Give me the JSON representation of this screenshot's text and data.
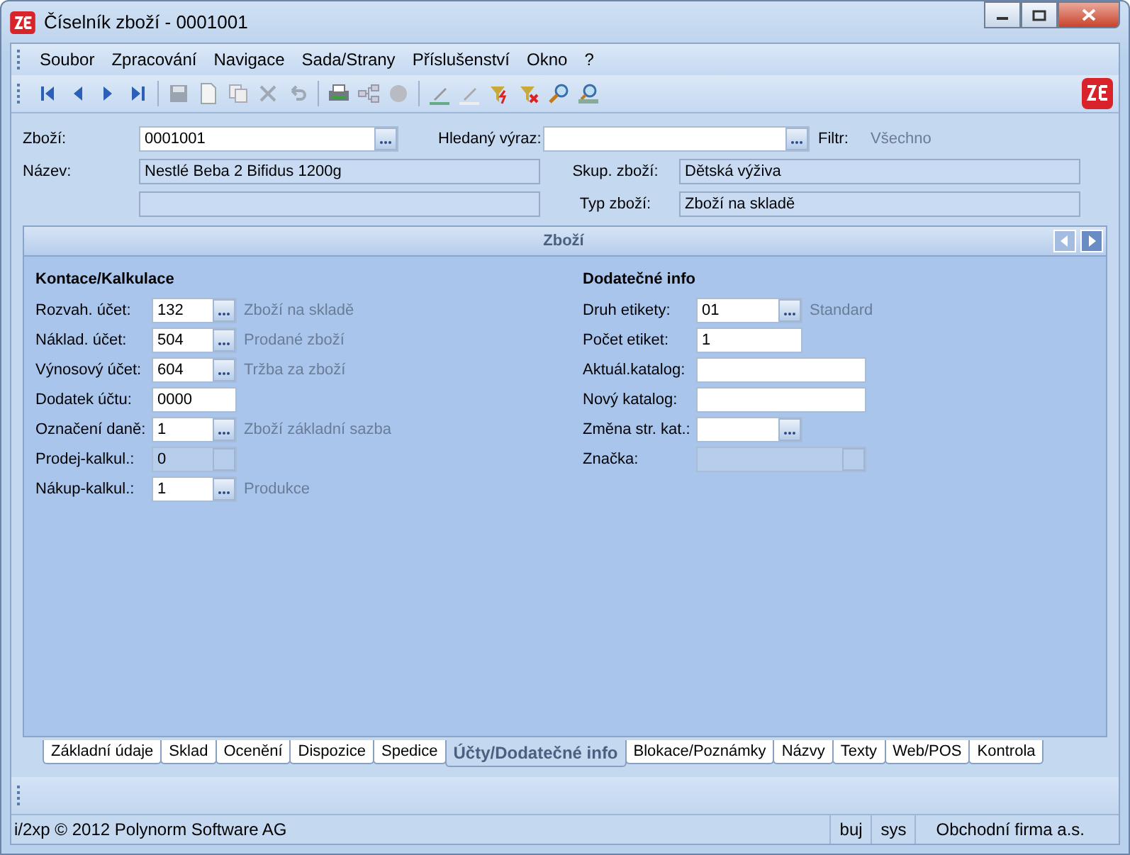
{
  "window": {
    "title": "Číselník zboží - 0001001"
  },
  "menu": [
    "Soubor",
    "Zpracování",
    "Navigace",
    "Sada/Strany",
    "Příslušenství",
    "Okno",
    "?"
  ],
  "header": {
    "zbozi": {
      "label": "Zboží:",
      "value": "0001001"
    },
    "search": {
      "label": "Hledaný výraz:"
    },
    "filter": {
      "label": "Filtr:",
      "value": "Všechno"
    },
    "nazev": {
      "label": "Název:",
      "value": "Nestlé Beba 2 Bifidus 1200g"
    },
    "skup": {
      "label": "Skup. zboží:",
      "value": "Dětská výživa"
    },
    "typ": {
      "label": "Typ zboží:",
      "value": "Zboží na skladě"
    }
  },
  "panel": {
    "title": "Zboží",
    "left": {
      "heading": "Kontace/Kalkulace",
      "fields": [
        {
          "label": "Rozvah. účet:",
          "value": "132",
          "kind": "lookup",
          "disabled": false,
          "note": "Zboží na skladě"
        },
        {
          "label": "Náklad. účet:",
          "value": "504",
          "kind": "lookup",
          "disabled": false,
          "note": "Prodané zboží"
        },
        {
          "label": "Výnosový účet:",
          "value": "604",
          "kind": "lookup",
          "disabled": false,
          "note": "Tržba za zboží"
        },
        {
          "label": "Dodatek účtu:",
          "value": "0000",
          "kind": "text",
          "disabled": false
        },
        {
          "label": "Označení daně:",
          "value": "1",
          "kind": "lookup",
          "disabled": false,
          "note": "Zboží základní sazba"
        },
        {
          "label": "Prodej-kalkul.:",
          "value": "0",
          "kind": "lookup",
          "disabled": true
        },
        {
          "label": "Nákup-kalkul.:",
          "value": "1",
          "kind": "lookup",
          "disabled": false,
          "note": "Produkce"
        }
      ]
    },
    "right": {
      "heading": "Dodatečné info",
      "fields": [
        {
          "label": "Druh etikety:",
          "value": "01",
          "kind": "lookup",
          "disabled": false,
          "note": "Standard"
        },
        {
          "label": "Počet etiket:",
          "value": "1",
          "kind": "text",
          "disabled": false
        },
        {
          "label": "Aktuál.katalog:",
          "kind": "wide_text",
          "disabled": false
        },
        {
          "label": "Nový katalog:",
          "kind": "wide_text",
          "disabled": false
        },
        {
          "label": "Změna str. kat.:",
          "kind": "lookup",
          "disabled": false
        },
        {
          "label": "Značka:",
          "kind": "wide_lookup",
          "disabled": true
        }
      ]
    }
  },
  "tabs": [
    {
      "label": "Základní údaje",
      "selected": false
    },
    {
      "label": "Sklad",
      "selected": false
    },
    {
      "label": "Ocenění",
      "selected": false
    },
    {
      "label": "Dispozice",
      "selected": false
    },
    {
      "label": "Spedice",
      "selected": false
    },
    {
      "label": "Účty/Dodatečné info",
      "selected": true
    },
    {
      "label": "Blokace/Poznámky",
      "selected": false
    },
    {
      "label": "Názvy",
      "selected": false
    },
    {
      "label": "Texty",
      "selected": false
    },
    {
      "label": "Web/POS",
      "selected": false
    },
    {
      "label": "Kontrola",
      "selected": false
    }
  ],
  "status_bar": {
    "copyright": "i/2xp © 2012 Polynorm Software AG",
    "user": "buj",
    "system": "sys",
    "company": "Obchodní firma a.s."
  }
}
